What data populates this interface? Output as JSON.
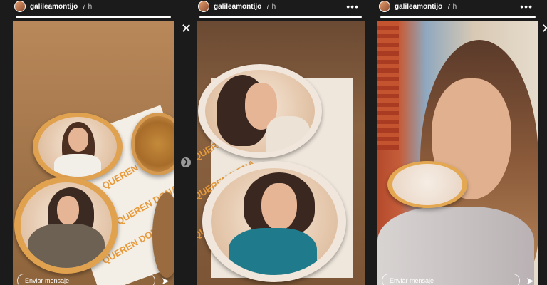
{
  "stories": {
    "username": "galileamontijo",
    "time": "7 h",
    "message_placeholder": "Enviar mensaje",
    "brand_text": "QUEREN DONA"
  },
  "icons": {
    "close": "close-icon",
    "next": "chevron-right-icon",
    "more": "more-options-icon",
    "send": "send-icon"
  },
  "colors": {
    "background": "#1b1b1b",
    "brand_orange": "#e79a3b",
    "box_brown": "#a3764b"
  },
  "progress": [
    1.0,
    1.0,
    1.0
  ]
}
